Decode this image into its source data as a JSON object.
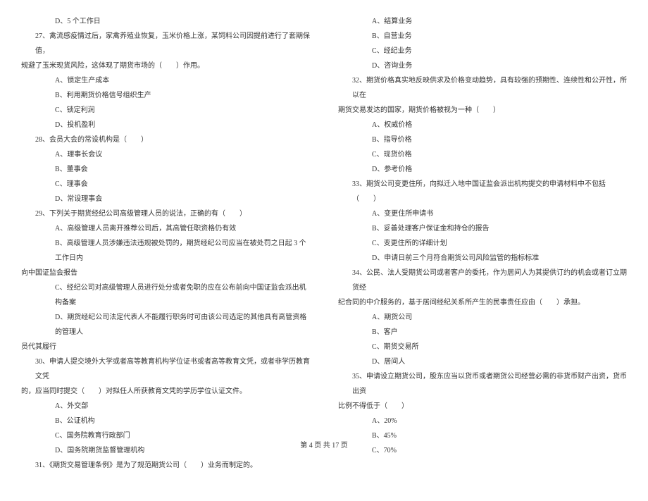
{
  "left_column": [
    {
      "text": "D、5 个工作日",
      "cls": "indent-1"
    },
    {
      "text": "27、禽流感疫情过后，家禽养殖业恢复，玉米价格上涨，某饲料公司因提前进行了套期保值，",
      "cls": "question"
    },
    {
      "text": "规避了玉米现货风险，这体现了期货市场的（　　）作用。",
      "cls": "no-indent"
    },
    {
      "text": "A、锁定生产成本",
      "cls": "indent-1"
    },
    {
      "text": "B、利用期货价格信号组织生产",
      "cls": "indent-1"
    },
    {
      "text": "C、锁定利润",
      "cls": "indent-1"
    },
    {
      "text": "D、投机盈利",
      "cls": "indent-1"
    },
    {
      "text": "28、会员大会的常设机构是（　　）",
      "cls": "question"
    },
    {
      "text": "A、理事长会议",
      "cls": "indent-1"
    },
    {
      "text": "B、董事会",
      "cls": "indent-1"
    },
    {
      "text": "C、理事会",
      "cls": "indent-1"
    },
    {
      "text": "D、常设理事会",
      "cls": "indent-1"
    },
    {
      "text": "29、下列关于期货经纪公司高级管理人员的说法，正确的有（　　）",
      "cls": "question"
    },
    {
      "text": "A、高级管理人员离开推荐公司后，其高管任职资格仍有效",
      "cls": "indent-1"
    },
    {
      "text": "B、高级管理人员涉嫌违法违规被处罚的，期货经纪公司应当在被处罚之日起 3 个工作日内",
      "cls": "indent-1"
    },
    {
      "text": "向中国证监会报告",
      "cls": "no-indent"
    },
    {
      "text": "C、经纪公司对高级管理人员进行处分或者免职的应在公布前向中国证监会派出机构备案",
      "cls": "indent-1"
    },
    {
      "text": "D、期货经纪公司法定代表人不能履行职务时可由该公司选定的其他具有高管资格的管理人",
      "cls": "indent-1"
    },
    {
      "text": "员代其履行",
      "cls": "no-indent"
    },
    {
      "text": "30、申请人提交境外大学或者高等教育机构学位证书或者高等教育文凭，或者非学历教育文凭",
      "cls": "question"
    },
    {
      "text": "的，应当同时提交（　　）对拟任人所获教育文凭的学历学位认证文件。",
      "cls": "no-indent"
    },
    {
      "text": "A、外交部",
      "cls": "indent-1"
    },
    {
      "text": "B、公证机构",
      "cls": "indent-1"
    },
    {
      "text": "C、国务院教育行政部门",
      "cls": "indent-1"
    },
    {
      "text": "D、国务院期货监督管理机构",
      "cls": "indent-1"
    },
    {
      "text": "31、《期货交易管理条例》是为了规范期货公司（　　）业务而制定的。",
      "cls": "question"
    }
  ],
  "right_column": [
    {
      "text": "A、结算业务",
      "cls": "indent-1"
    },
    {
      "text": "B、自营业务",
      "cls": "indent-1"
    },
    {
      "text": "C、经纪业务",
      "cls": "indent-1"
    },
    {
      "text": "D、咨询业务",
      "cls": "indent-1"
    },
    {
      "text": "32、期货价格真实地反映供求及价格变动趋势，具有较强的预期性、连续性和公开性，所以在",
      "cls": "question"
    },
    {
      "text": "期货交易发达的国家，期货价格被视为一种（　　）",
      "cls": "no-indent"
    },
    {
      "text": "A、权威价格",
      "cls": "indent-1"
    },
    {
      "text": "B、指导价格",
      "cls": "indent-1"
    },
    {
      "text": "C、现货价格",
      "cls": "indent-1"
    },
    {
      "text": "D、参考价格",
      "cls": "indent-1"
    },
    {
      "text": "33、期货公司变更住所，向拟迁入地中国证监会派出机构提交的申请材料中不包括（　　）",
      "cls": "question"
    },
    {
      "text": "A、变更住所申请书",
      "cls": "indent-1"
    },
    {
      "text": "B、妥善处理客户保证金和持仓的报告",
      "cls": "indent-1"
    },
    {
      "text": "C、变更住所的详细计划",
      "cls": "indent-1"
    },
    {
      "text": "D、申请日前三个月符合期货公司风险监管的指标标准",
      "cls": "indent-1"
    },
    {
      "text": "34、公民、法人受期货公司或者客户的委托，作为居间人为其提供订约的机会或者订立期货经",
      "cls": "question"
    },
    {
      "text": "纪合同的中介服务的，基于居间经纪关系所产生的民事责任应由（　　）承担。",
      "cls": "no-indent"
    },
    {
      "text": "A、期货公司",
      "cls": "indent-1"
    },
    {
      "text": "B、客户",
      "cls": "indent-1"
    },
    {
      "text": "C、期货交易所",
      "cls": "indent-1"
    },
    {
      "text": "D、居间人",
      "cls": "indent-1"
    },
    {
      "text": "35、申请设立期货公司，股东应当以货币或者期货公司经营必需的非货币财产出资，货币出资",
      "cls": "question"
    },
    {
      "text": "比例不得低于（　　）",
      "cls": "no-indent"
    },
    {
      "text": "A、20%",
      "cls": "indent-1"
    },
    {
      "text": "B、45%",
      "cls": "indent-1"
    },
    {
      "text": "C、70%",
      "cls": "indent-1"
    }
  ],
  "footer": "第 4 页 共 17 页"
}
